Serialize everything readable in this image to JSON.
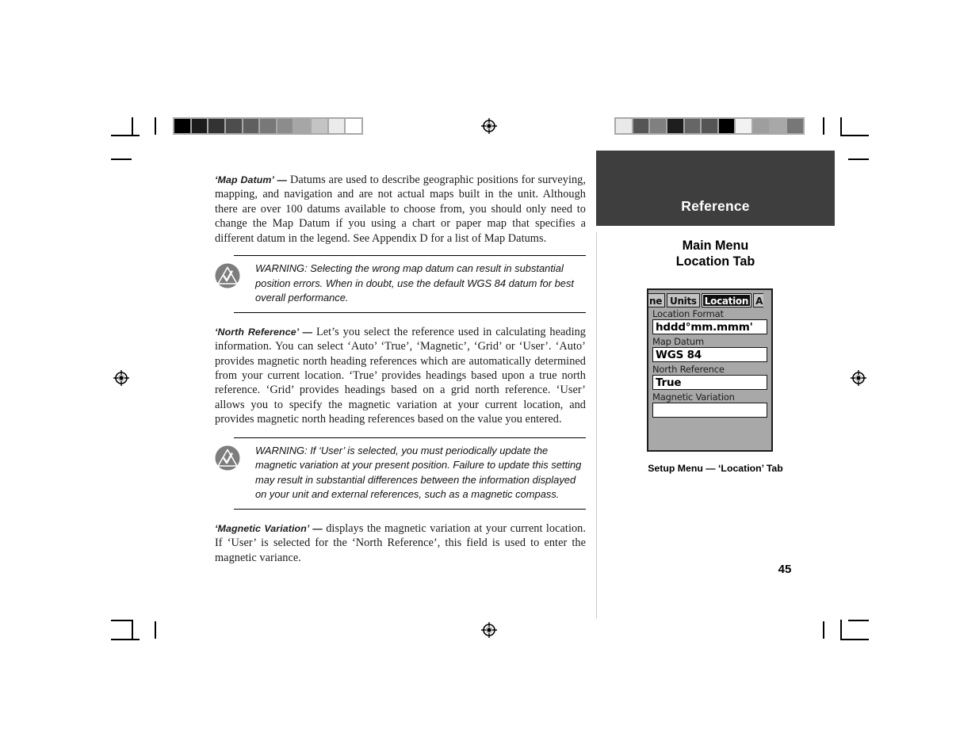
{
  "document": {
    "page_number": "45",
    "section_title": "Reference"
  },
  "body": {
    "paragraphs": [
      {
        "lead": "‘Map Datum’ —",
        "text": " Datums are used to describe geographic positions for surveying, mapping, and navigation and are not actual maps built in the unit.  Although there are over 100 datums available to choose from, you should only need to change the Map Datum if you using a chart or paper map that specifies a different datum in the legend.  See Appendix D for a list of Map Datums."
      },
      {
        "lead": "‘North Reference’ —",
        "text": "  Let’s you select the reference used in calculating heading information.  You can select ‘Auto’ ‘True’, ‘Magnetic’, ‘Grid’ or ‘User’. ‘Auto’ provides magnetic north heading references which are automatically determined from your current location.  ‘True’ provides headings based upon a true north reference.  ‘Grid’ provides headings based on a grid north reference. ‘User’ allows you to specify the magnetic variation at your current location, and provides magnetic north heading references based on the value you entered."
      },
      {
        "lead": "‘Magnetic Variation’ —",
        "text": " displays the magnetic variation at your current location.  If ‘User’ is selected for the ‘North Reference’, this field is used to enter the magnetic variance."
      }
    ],
    "warnings": [
      {
        "icon": "warning-triangle-icon",
        "text": "WARNING: Selecting the wrong map datum can result in substantial position errors.  When in doubt, use the default WGS 84 datum for best overall performance."
      },
      {
        "icon": "warning-triangle-icon",
        "text": "WARNING: If ‘User’ is selected, you must periodically update the magnetic variation at your present position.  Failure to update this setting may result in substantial differences between the information displayed on your unit and external references, such as a magnetic compass."
      }
    ]
  },
  "sidebar": {
    "band_label": "Reference",
    "heading_line1": "Main Menu",
    "heading_line2": "Location Tab",
    "caption": "Setup Menu — ‘Location’ Tab"
  },
  "gps_screen": {
    "tabs": [
      {
        "label": "ne",
        "active": false,
        "partial": "left"
      },
      {
        "label": "Units",
        "active": false,
        "partial": "none"
      },
      {
        "label": "Location",
        "active": true,
        "partial": "none"
      },
      {
        "label": "A",
        "active": false,
        "partial": "right"
      }
    ],
    "fields": [
      {
        "label": "Location Format",
        "value": "hddd°mm.mmm'"
      },
      {
        "label": "Map Datum",
        "value": "WGS 84"
      },
      {
        "label": "North Reference",
        "value": "True"
      },
      {
        "label": "Magnetic Variation",
        "value": ""
      }
    ]
  },
  "prepress": {
    "wedge_left": {
      "name": "grayscale-step-wedge",
      "swatches": [
        "#000000",
        "#1c1c1c",
        "#333333",
        "#4d4d4d",
        "#5f5f5f",
        "#787878",
        "#8c8c8c",
        "#a6a6a6",
        "#c4c4c4",
        "#ebebeb",
        "#ffffff"
      ]
    },
    "wedge_right": {
      "name": "grayscale-control-patches",
      "swatches": [
        "#e9e9e9",
        "#555555",
        "#808080",
        "#1e1e1e",
        "#666666",
        "#555555",
        "#000000",
        "#f2f2f2",
        "#9e9e9e",
        "#a8a8a8",
        "#777777"
      ]
    }
  }
}
